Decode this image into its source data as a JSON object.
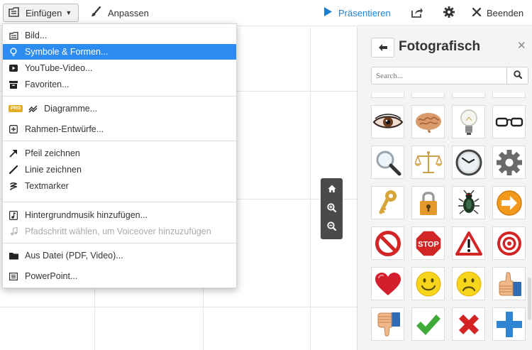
{
  "toolbar": {
    "insert_label": "Einfügen",
    "customize_label": "Anpassen",
    "present_label": "Präsentieren",
    "exit_label": "Beenden"
  },
  "menu": {
    "items": [
      {
        "label": "Bild...",
        "icon": "image-icon"
      },
      {
        "label": "Symbole & Formen...",
        "icon": "lightbulb-icon",
        "active": true
      },
      {
        "label": "YouTube-Video...",
        "icon": "youtube-icon"
      },
      {
        "label": "Favoriten...",
        "icon": "archive-icon"
      },
      {
        "label": "Diagramme...",
        "icon": "chart-icon",
        "badge": "PRO"
      },
      {
        "label": "Rahmen-Entwürfe...",
        "icon": "frame-plus-icon"
      },
      {
        "label": "Pfeil zeichnen",
        "icon": "arrow-icon"
      },
      {
        "label": "Linie zeichnen",
        "icon": "line-icon"
      },
      {
        "label": "Textmarker",
        "icon": "highlighter-icon"
      },
      {
        "label": "Hintergrundmusik hinzufügen...",
        "icon": "music-icon"
      },
      {
        "label": "Pfadschritt wählen, um Voiceover hinzuzufügen",
        "icon": "note-icon",
        "disabled": true
      },
      {
        "label": "Aus Datei (PDF, Video)...",
        "icon": "folder-icon"
      },
      {
        "label": "PowerPoint...",
        "icon": "powerpoint-icon"
      }
    ]
  },
  "panel": {
    "title": "Fotografisch",
    "search_placeholder": "Search...",
    "tiles": [
      "eye",
      "brain",
      "light-bulb",
      "glasses",
      "magnifier",
      "scales",
      "clock",
      "gear",
      "key",
      "padlock",
      "beetle",
      "arrow-right",
      "no-sign",
      "stop-sign",
      "warning-sign",
      "target",
      "heart",
      "smiley-happy",
      "smiley-sad",
      "thumbs-up",
      "thumbs-down",
      "checkmark",
      "cross",
      "plus"
    ],
    "stop_text": "STOP"
  },
  "colors": {
    "accent": "#2d8cef",
    "present": "#1a7fd1",
    "pro_badge": "#e2ad22"
  }
}
